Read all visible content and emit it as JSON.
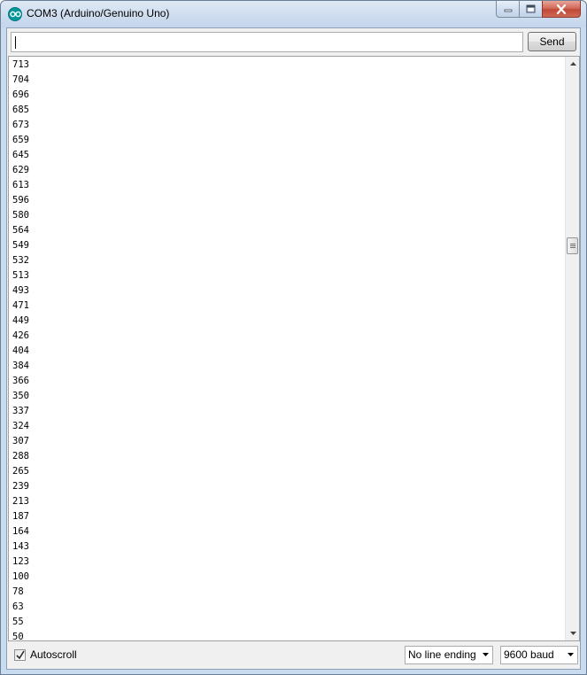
{
  "window": {
    "title": "COM3 (Arduino/Genuino Uno)",
    "controls": {
      "minimize": "minimize-icon",
      "maximize": "maximize-icon",
      "close": "close-icon"
    }
  },
  "input": {
    "value": "",
    "placeholder": ""
  },
  "toolbar": {
    "send_label": "Send"
  },
  "serial_output": {
    "lines": [
      "713",
      "704",
      "696",
      "685",
      "673",
      "659",
      "645",
      "629",
      "613",
      "596",
      "580",
      "564",
      "549",
      "532",
      "513",
      "493",
      "471",
      "449",
      "426",
      "404",
      "384",
      "366",
      "350",
      "337",
      "324",
      "307",
      "288",
      "265",
      "239",
      "213",
      "187",
      "164",
      "143",
      "123",
      "100",
      "78",
      "63",
      "55",
      "50"
    ]
  },
  "footer": {
    "autoscroll_label": "Autoscroll",
    "autoscroll_checked": true,
    "line_ending": "No line ending",
    "baud_rate": "9600 baud"
  },
  "colors": {
    "title_bar": "#cddcee",
    "arduino_teal": "#00979c",
    "close_button": "#c14a38"
  }
}
